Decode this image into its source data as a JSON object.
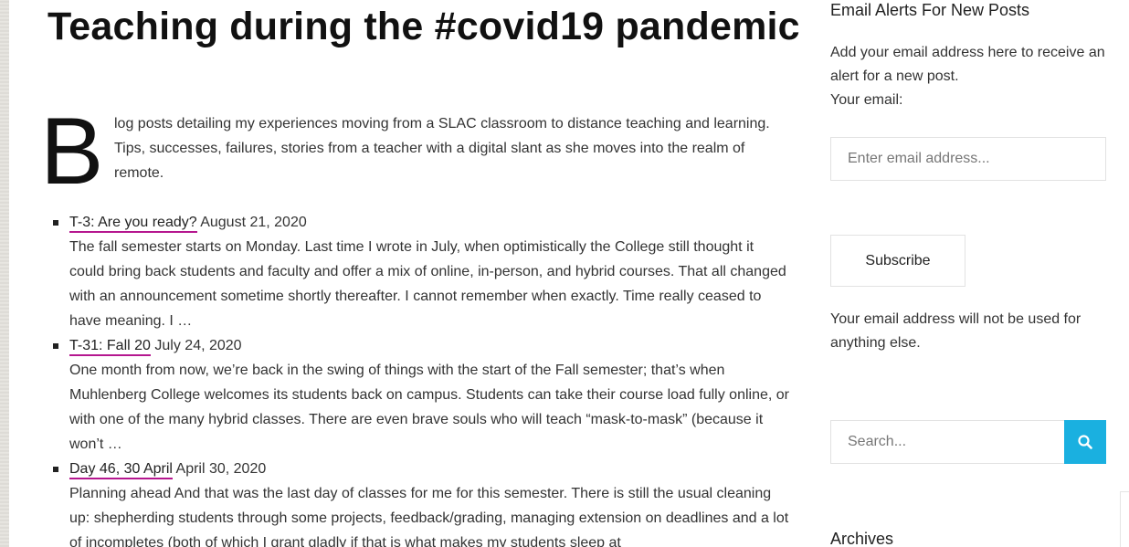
{
  "main": {
    "title": "Teaching during the #covid19 pandemic",
    "intro": {
      "dropcap": "B",
      "text": "log posts detailing my experiences moving from a SLAC classroom to distance teaching and learning. Tips, successes, failures, stories from a teacher with a digital slant as she moves into the realm of remote."
    },
    "posts": [
      {
        "title": "T-3: Are you ready?",
        "date": "August 21, 2020",
        "excerpt": "The fall semester starts on Monday. Last time I wrote in July, when optimistically the College still thought it could bring back students and faculty and offer a mix of online, in-person, and hybrid courses. That all changed with an announcement sometime shortly thereafter. I cannot remember when exactly. Time really ceased to have meaning. I …"
      },
      {
        "title": "T-31: Fall 20",
        "date": "July 24, 2020",
        "excerpt": "One month from now, we’re back in the swing of things with the start of the Fall semester; that’s when Muhlenberg College welcomes its students back on campus. Students can take their course load fully online, or with one of the many hybrid classes. There are even brave souls who will teach “mask-to-mask” (because it won’t …"
      },
      {
        "title": "Day 46, 30 April",
        "date": "April 30, 2020",
        "excerpt": "Planning ahead And that was the last day of classes for me for this semester. There is still the usual cleaning up: shepherding students through some projects, feedback/grading, managing extension on deadlines and a lot of incompletes (both of which I grant gladly if that is what makes my students sleep at"
      }
    ]
  },
  "sidebar": {
    "email_widget": {
      "title": "Email Alerts For New Posts",
      "description": "Add your email address here to receive an alert for a new post.",
      "email_label": "Your email:",
      "email_placeholder": "Enter email address...",
      "subscribe_label": "Subscribe",
      "note": "Your email address will not be used for anything else."
    },
    "search": {
      "placeholder": "Search...",
      "icon": "search-icon"
    },
    "archives_title": "Archives"
  },
  "colors": {
    "link_underline": "#b5178f",
    "search_button": "#1ab0e0"
  }
}
